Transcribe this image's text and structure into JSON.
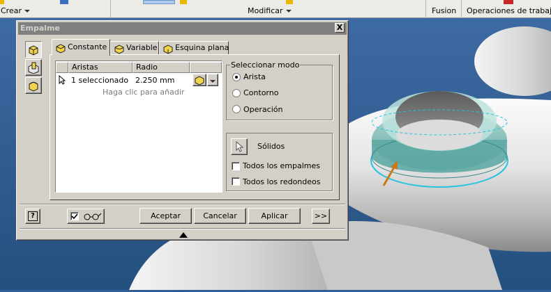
{
  "ribbon": {
    "panels": [
      {
        "label": "Crear",
        "has_dropdown": true
      },
      {
        "label": "Modificar",
        "has_dropdown": true
      },
      {
        "label": "Fusion",
        "has_dropdown": false
      },
      {
        "label": "Operaciones de trabajo",
        "has_dropdown": false
      }
    ]
  },
  "dialog": {
    "title": "Empalme",
    "close_label": "X",
    "side_tools": [
      "edge-fillet-icon",
      "face-fillet-icon",
      "full-round-fillet-icon"
    ],
    "tabs": [
      {
        "label": "Constante",
        "icon": "constant-fillet-icon",
        "active": true
      },
      {
        "label": "Variable",
        "icon": "variable-fillet-icon",
        "active": false
      },
      {
        "label": "Esquina plana",
        "icon": "setback-corner-icon",
        "active": false
      }
    ],
    "grid": {
      "columns": [
        "Aristas",
        "Radio"
      ],
      "rows": [
        {
          "edges": "1 seleccionado",
          "radius": "2.250 mm"
        }
      ],
      "add_hint": "Haga clic para añadir"
    },
    "select_mode": {
      "legend": "Seleccionar modo",
      "options": [
        "Arista",
        "Contorno",
        "Operación"
      ],
      "selected": "Arista"
    },
    "solids": {
      "label": "Sólidos",
      "checks": [
        {
          "label": "Todos los empalmes",
          "checked": false
        },
        {
          "label": "Todos los redondeos",
          "checked": false
        }
      ]
    },
    "preview_checked": true,
    "buttons": {
      "help": "?",
      "ok": "Aceptar",
      "cancel": "Cancelar",
      "apply": "Aplicar",
      "more": ">>"
    }
  },
  "colors": {
    "background": "#2f5d96",
    "dialog": "#d4d0c8",
    "title_bar": "#808080",
    "highlight_edge": "#27c3e0",
    "fillet_surface": "#6fb6b0",
    "arrow": "#c97a1a"
  }
}
